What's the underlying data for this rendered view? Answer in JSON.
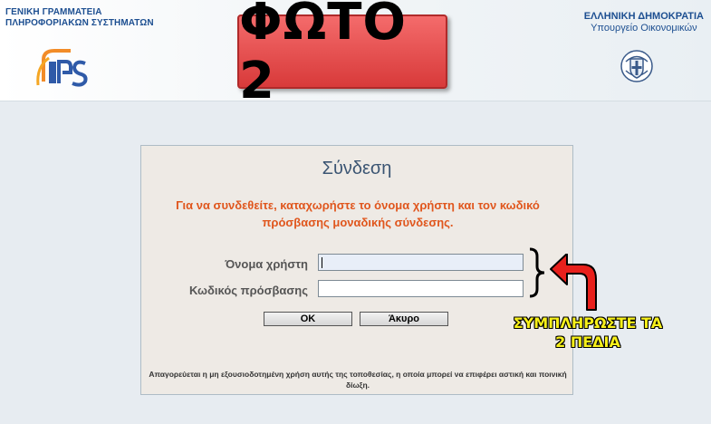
{
  "header": {
    "gsis_line1": "ΓΕΝΙΚΗ ΓΡΑΜΜΑΤΕΙΑ",
    "gsis_line2": "ΠΛΗΡΟΦΟΡΙΑΚΩΝ ΣΥΣΤΗΜΑΤΩΝ",
    "gov_line1": "ΕΛΛΗΝΙΚΗ ΔΗΜΟΚΡΑΤΙΑ",
    "gov_line2": "Υπουργείο Οικονομικών"
  },
  "banner": {
    "text": "ΦΩΤΟ 2",
    "color": "#e04848"
  },
  "login": {
    "title": "Σύνδεση",
    "instruction": "Για να συνδεθείτε, καταχωρήστε το όνομα χρήστη και τον κωδικό πρόσβασης μοναδικής σύνδεσης.",
    "username_label": "Όνομα χρήστη",
    "username_value": "",
    "password_label": "Κωδικός πρόσβασης",
    "password_value": "",
    "ok_label": "OK",
    "cancel_label": "Άκυρο",
    "legal_notice": "Απαγορεύεται η μη εξουσιοδοτημένη χρήση αυτής της τοποθεσίας, η οποία μπορεί να επιφέρει αστική και ποινική δίωξη."
  },
  "annotation": {
    "line1": "ΣΥΜΠΛΗΡΩΣΤΕ ΤΑ",
    "line2": "2 ΠΕΔΙΑ",
    "text_color": "#f7f01a",
    "arrow_color": "#e8201c"
  },
  "colors": {
    "instruction_orange": "#e0561d",
    "title_blue": "#3b5573",
    "brand_blue": "#1d4f91"
  }
}
